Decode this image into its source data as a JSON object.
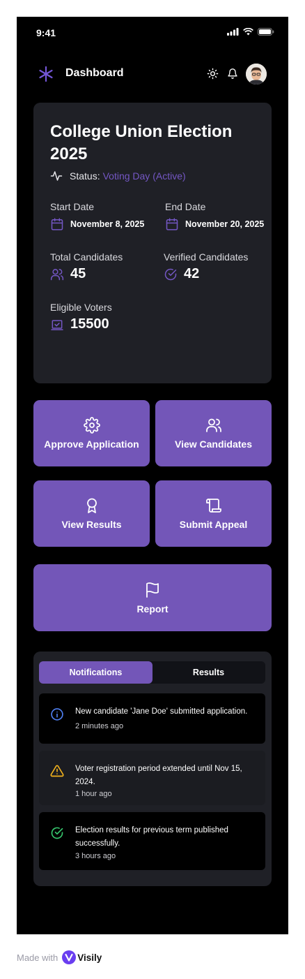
{
  "status_bar": {
    "time": "9:41"
  },
  "header": {
    "title": "Dashboard"
  },
  "election": {
    "title": "College Union Election 2025",
    "status_label": "Status:",
    "status_value": "Voting Day (Active)",
    "start_date_label": "Start Date",
    "start_date": "November 8, 2025",
    "end_date_label": "End Date",
    "end_date": "November 20, 2025",
    "total_candidates_label": "Total Candidates",
    "total_candidates": "45",
    "verified_candidates_label": "Verified Candidates",
    "verified_candidates": "42",
    "eligible_voters_label": "Eligible Voters",
    "eligible_voters": "15500"
  },
  "actions": {
    "approve": "Approve Application",
    "view_candidates": "View Candidates",
    "view_results": "View Results",
    "submit_appeal": "Submit Appeal",
    "report": "Report"
  },
  "tabs": {
    "notifications": "Notifications",
    "results": "Results"
  },
  "notifications": [
    {
      "message": "New candidate 'Jane Doe' submitted application.",
      "time": "2 minutes ago",
      "icon": "info-icon"
    },
    {
      "message": "Voter registration period extended until Nov 15, 2024.",
      "time": "1 hour ago",
      "icon": "warning-icon"
    },
    {
      "message": "Election results for previous term published successfully.",
      "time": "3 hours ago",
      "icon": "check-circle-icon"
    }
  ],
  "footer": {
    "made_with": "Made with",
    "brand": "Visily"
  },
  "colors": {
    "accent": "#7356b8",
    "background": "#000000",
    "card": "#1f2026",
    "info": "#4f7ff0",
    "warning": "#f2b21d",
    "success": "#36c46c"
  }
}
